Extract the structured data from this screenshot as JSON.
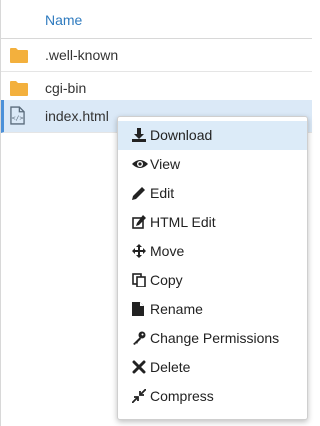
{
  "header": {
    "name_label": "Name"
  },
  "files": [
    {
      "name": ".well-known",
      "icon": "folder-icon"
    },
    {
      "name": "cgi-bin",
      "icon": "folder-icon"
    },
    {
      "name": "index.html",
      "icon": "html-file-icon"
    }
  ],
  "context_menu": {
    "items": [
      {
        "label": "Download",
        "icon": "download-icon"
      },
      {
        "label": "View",
        "icon": "eye-icon"
      },
      {
        "label": "Edit",
        "icon": "pencil-icon"
      },
      {
        "label": "HTML Edit",
        "icon": "edit-box-icon"
      },
      {
        "label": "Move",
        "icon": "move-arrows-icon"
      },
      {
        "label": "Copy",
        "icon": "copy-icon"
      },
      {
        "label": "Rename",
        "icon": "file-icon"
      },
      {
        "label": "Change Permissions",
        "icon": "key-icon"
      },
      {
        "label": "Delete",
        "icon": "x-icon"
      },
      {
        "label": "Compress",
        "icon": "compress-icon"
      }
    ]
  },
  "colors": {
    "accent": "#2f7bbf",
    "folder": "#f3b03d",
    "selected_row": "#dbe9f7",
    "active_menu_item": "#dcebf8"
  }
}
